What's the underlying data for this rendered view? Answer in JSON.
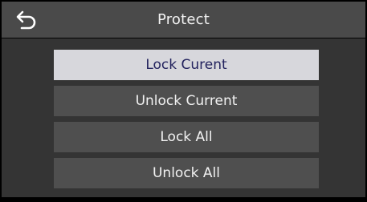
{
  "header": {
    "title": "Protect",
    "back_icon": "back-arrow-icon"
  },
  "menu": {
    "items": [
      {
        "label": "Lock Curent",
        "selected": true
      },
      {
        "label": "Unlock Current",
        "selected": false
      },
      {
        "label": "Lock All",
        "selected": false
      },
      {
        "label": "Unlock All",
        "selected": false
      }
    ]
  },
  "colors": {
    "title_bar": "#4a4a4a",
    "content_bg": "#343434",
    "button_bg": "#4f4f4f",
    "button_selected_bg": "#d7d7dc",
    "button_selected_text": "#23235e",
    "text": "#f2f2f2"
  }
}
